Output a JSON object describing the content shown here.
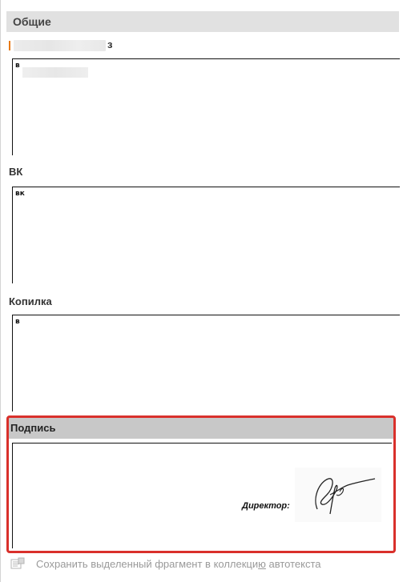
{
  "gallery": {
    "category": "Общие",
    "entries": [
      {
        "title_suffix": "з",
        "preview_text": "в"
      },
      {
        "title": "ВК",
        "preview_text": "вк"
      },
      {
        "title": "Копилка",
        "preview_text": "в"
      }
    ],
    "selected_entry": {
      "title": "Подпись",
      "preview_label": "Директор:"
    }
  },
  "footer": {
    "save_label_part1": "Сохранить выделенный фрагмент в коллекци",
    "save_label_underlined": "ю",
    "save_label_part2": " автотекста",
    "icon": "save-autotext-icon"
  },
  "colors": {
    "selection_outline": "#d9302b",
    "category_header_bg": "#e1e1e1",
    "selected_header_bg": "#c8c8c8"
  }
}
